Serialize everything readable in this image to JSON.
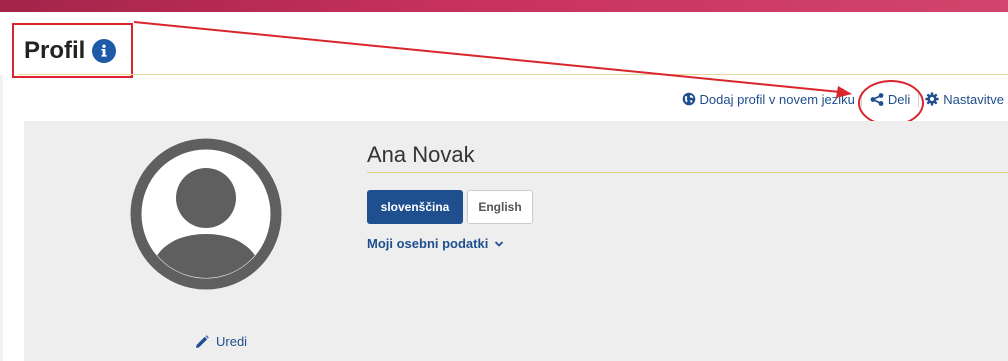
{
  "header": {
    "title": "Profil",
    "accent_color": "#c7315d",
    "annotation_color": "#d9252b"
  },
  "actions": {
    "add_language": "Dodaj profil v novem jeziku",
    "share": "Deli",
    "settings": "Nastavitve"
  },
  "profile": {
    "name": "Ana Novak",
    "edit_label": "Uredi",
    "languages": [
      "slovenščina",
      "English"
    ],
    "active_language": "slovenščina",
    "personal_data_label": "Moji osebni podatki"
  },
  "icons": {
    "info": "info-icon",
    "globe": "globe-icon",
    "share": "share-icon",
    "gear": "gear-icon",
    "pencil": "pencil-icon",
    "chevron": "chevron-down-icon",
    "avatar": "user-avatar-icon"
  }
}
